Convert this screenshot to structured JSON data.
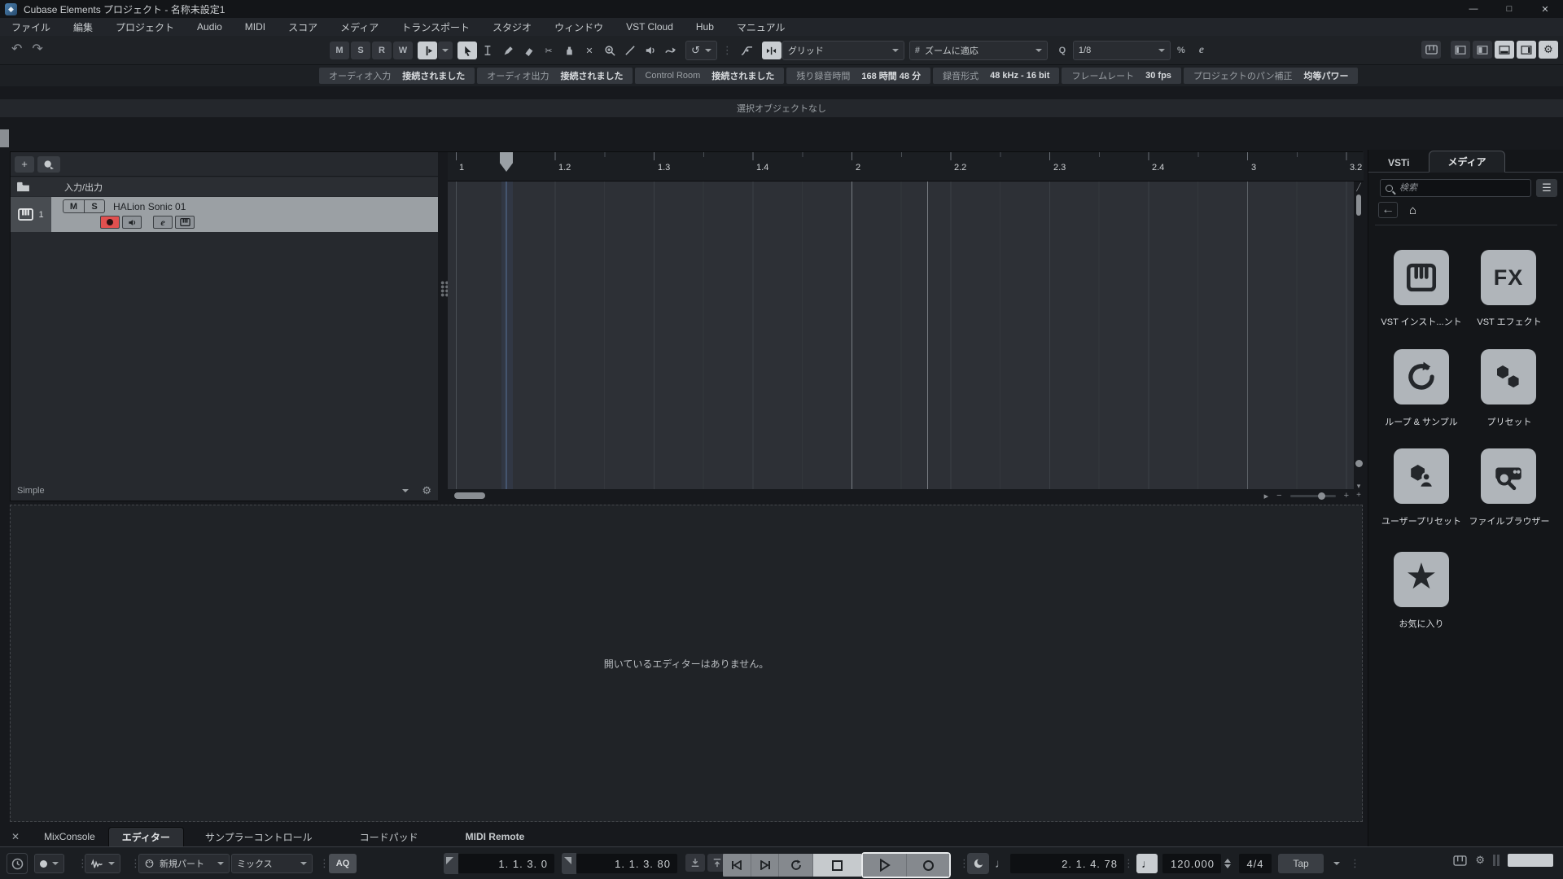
{
  "window": {
    "title": "Cubase Elements プロジェクト - 名称未設定1",
    "minimize": "—",
    "maximize": "□",
    "close": "✕"
  },
  "menu": {
    "items": [
      "ファイル",
      "編集",
      "プロジェクト",
      "Audio",
      "MIDI",
      "スコア",
      "メディア",
      "トランスポート",
      "スタジオ",
      "ウィンドウ",
      "VST Cloud",
      "Hub",
      "マニュアル"
    ]
  },
  "toolbar": {
    "automation": {
      "m": "M",
      "s": "S",
      "r": "R",
      "w": "W"
    },
    "grid_mode": "グリッド",
    "zoom_preset": "ズームに適応",
    "quantize_q": "Q",
    "quantize_preset": "1/8",
    "hash": "#",
    "iq": "%",
    "edit_e": "e"
  },
  "info_bar": {
    "segments": [
      {
        "label": "オーディオ入力",
        "value": "接続されました"
      },
      {
        "label": "オーディオ出力",
        "value": "接続されました"
      },
      {
        "label": "Control Room",
        "value": "接続されました"
      },
      {
        "label": "残り録音時間",
        "value": "168 時間 48 分"
      },
      {
        "label": "録音形式",
        "value": "48 kHz - 16 bit"
      },
      {
        "label": "フレームレート",
        "value": "30 fps"
      },
      {
        "label": "プロジェクトのパン補正",
        "value": "均等パワー"
      }
    ]
  },
  "status_line": {
    "text": "選択オブジェクトなし"
  },
  "track_list": {
    "io_folder_label": "入力/出力",
    "track": {
      "number": "1",
      "name": "HALion Sonic 01",
      "mute": "M",
      "solo": "S",
      "edit": "e"
    },
    "preset_name": "Simple"
  },
  "ruler": {
    "ticks": [
      "1",
      "1.2",
      "1.3",
      "1.4",
      "2",
      "2.2",
      "2.3",
      "2.4",
      "3",
      "3.2"
    ]
  },
  "right_zone": {
    "tabs": {
      "vsti": "VSTi",
      "media": "メディア"
    },
    "search_placeholder": "検索",
    "tiles": [
      {
        "label": "VST インスト...ント"
      },
      {
        "label": "VST エフェクト",
        "fx": "FX"
      },
      {
        "label": "ループ & サンプル"
      },
      {
        "label": "プリセット"
      },
      {
        "label": "ユーザープリセット"
      },
      {
        "label": "ファイルブラウザー"
      },
      {
        "label": "お気に入り"
      }
    ]
  },
  "lower_zone": {
    "empty_text": "開いているエディターはありません。",
    "close": "✕",
    "tabs": [
      "MixConsole",
      "エディター",
      "サンプラーコントロール",
      "コードパッド",
      "MIDI Remote"
    ]
  },
  "transport": {
    "insert_mode": "新規パート",
    "record_mix": "ミックス",
    "aq": "AQ",
    "left_locator": "1. 1. 3.  0",
    "right_locator": "1. 1. 3. 80",
    "secondary_time": "2. 1. 4. 78",
    "tempo": "120.000",
    "time_signature": "4/4",
    "tap": "Tap"
  },
  "colors": {
    "accent_record": "#e0504f",
    "selected_track": "#9ba0a4",
    "active_button": "#c9cdd1"
  }
}
